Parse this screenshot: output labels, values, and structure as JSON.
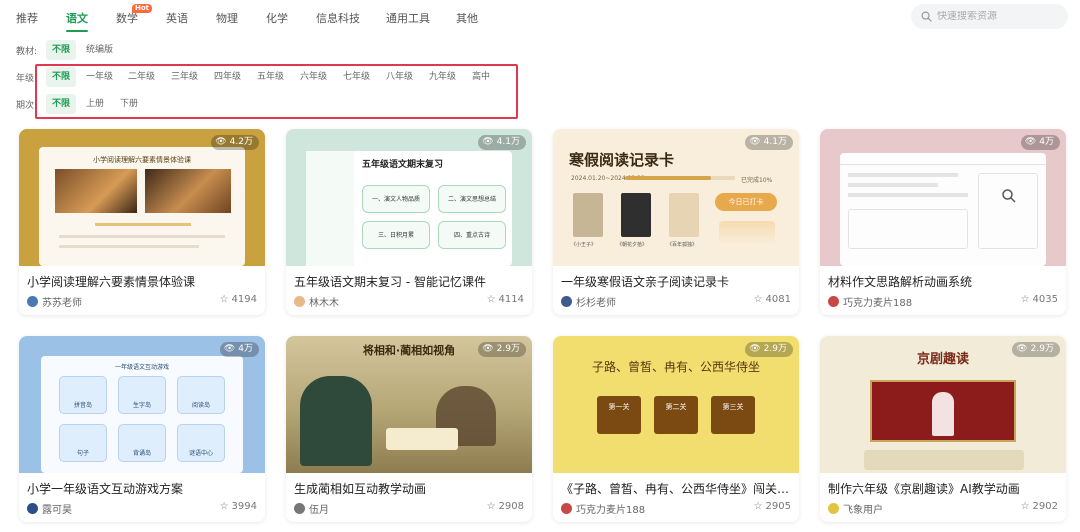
{
  "nav": {
    "tabs": [
      "推荐",
      "语文",
      "数学",
      "英语",
      "物理",
      "化学",
      "信息科技",
      "通用工具",
      "其他"
    ],
    "hot_badge": "Hot",
    "search_placeholder": "快速搜索资源"
  },
  "filters": {
    "textbook": {
      "label": "教材:",
      "options": [
        "不限",
        "统编版"
      ],
      "selected": "不限"
    },
    "grade": {
      "label": "年级",
      "options": [
        "不限",
        "一年级",
        "二年级",
        "三年级",
        "四年级",
        "五年级",
        "六年级",
        "七年级",
        "八年级",
        "九年级",
        "高中"
      ],
      "selected": "不限"
    },
    "term": {
      "label": "期次",
      "options": [
        "不限",
        "上册",
        "下册"
      ],
      "selected": "不限"
    }
  },
  "cards": [
    {
      "title": "小学阅读理解六要素情景体验课",
      "author": "苏苏老师",
      "views": "4.2万",
      "stars": "4194",
      "thumb_text": [
        "小学阅读理解六要素情景体验课"
      ]
    },
    {
      "title": "五年级语文期末复习 - 智能记忆课件",
      "author": "林木木",
      "views": "4.1万",
      "stars": "4114",
      "thumb_text": [
        "五年级语文期末复习",
        "一、演文人物品质",
        "二、演文思想总结",
        "三、日积月累",
        "四、重点古诗"
      ]
    },
    {
      "title": "一年级寒假语文亲子阅读记录卡",
      "author": "杉杉老师",
      "views": "4.1万",
      "stars": "4081",
      "thumb_text": [
        "寒假阅读记录卡",
        "2024.01.20~2024.02.29",
        "已完成10%",
        "《小王子》",
        "《朝花夕拾》",
        "《百年孤独》",
        "今日已打卡"
      ]
    },
    {
      "title": "材料作文思路解析动画系统",
      "author": "巧克力麦片188",
      "views": "4万",
      "stars": "4035",
      "thumb_text": []
    },
    {
      "title": "小学一年级语文互动游戏方案",
      "author": "露可昊",
      "views": "4万",
      "stars": "3994",
      "thumb_text": [
        "一年级语文互动游戏",
        "拼音岛",
        "生字岛",
        "阅读岛",
        "句子",
        "背诵岛",
        "谜语中心"
      ]
    },
    {
      "title": "生成蔺相如互动教学动画",
      "author": "伍月",
      "views": "2.9万",
      "stars": "2908",
      "thumb_text": [
        "将相和·蔺相如视角"
      ]
    },
    {
      "title": "《子路、曾皙、冉有、公西华侍坐》闯关游戏",
      "author": "巧克力麦片188",
      "views": "2.9万",
      "stars": "2905",
      "thumb_text": [
        "子路、曾皙、冉有、公西华侍坐",
        "第一关",
        "第二关",
        "第三关"
      ]
    },
    {
      "title": "制作六年级《京剧趣读》AI教学动画",
      "author": "飞象用户",
      "views": "2.9万",
      "stars": "2902",
      "thumb_text": [
        "京剧趣读"
      ]
    }
  ],
  "colors": {
    "accent": "#1f9d55",
    "highlight": "#e0394f",
    "hot": "#ff6a3d"
  }
}
